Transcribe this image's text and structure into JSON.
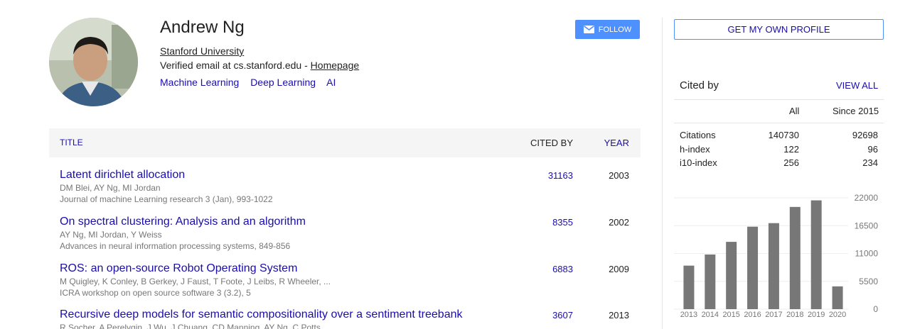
{
  "profile": {
    "name": "Andrew Ng",
    "affiliation": "Stanford University",
    "email_text": "Verified email at cs.stanford.edu - ",
    "homepage": "Homepage",
    "interests": [
      "Machine Learning",
      "Deep Learning",
      "AI"
    ],
    "follow_label": "FOLLOW",
    "own_profile_label": "GET MY OWN PROFILE"
  },
  "table": {
    "title_header": "TITLE",
    "cited_header": "CITED BY",
    "year_header": "YEAR",
    "articles": [
      {
        "title": "Latent dirichlet allocation",
        "authors": "DM Blei, AY Ng, MI Jordan",
        "venue": "Journal of machine Learning research 3 (Jan), 993-1022",
        "cited": "31163",
        "year": "2003"
      },
      {
        "title": "On spectral clustering: Analysis and an algorithm",
        "authors": "AY Ng, MI Jordan, Y Weiss",
        "venue": "Advances in neural information processing systems, 849-856",
        "cited": "8355",
        "year": "2002"
      },
      {
        "title": "ROS: an open-source Robot Operating System",
        "authors": "M Quigley, K Conley, B Gerkey, J Faust, T Foote, J Leibs, R Wheeler, ...",
        "venue": "ICRA workshop on open source software 3 (3.2), 5",
        "cited": "6883",
        "year": "2009"
      },
      {
        "title": "Recursive deep models for semantic compositionality over a sentiment treebank",
        "authors": "R Socher, A Perelygin, J Wu, J Chuang, CD Manning, AY Ng, C Potts",
        "venue": "",
        "cited": "3607",
        "year": "2013"
      }
    ]
  },
  "cited_by": {
    "title": "Cited by",
    "view_all": "VIEW ALL",
    "col_all": "All",
    "col_since": "Since 2015",
    "rows": [
      {
        "label": "Citations",
        "all": "140730",
        "since": "92698"
      },
      {
        "label": "h-index",
        "all": "122",
        "since": "96"
      },
      {
        "label": "i10-index",
        "all": "256",
        "since": "234"
      }
    ]
  },
  "chart_data": {
    "type": "bar",
    "categories": [
      "2013",
      "2014",
      "2015",
      "2016",
      "2017",
      "2018",
      "2019",
      "2020"
    ],
    "values": [
      8600,
      10800,
      13300,
      16300,
      17000,
      20200,
      21500,
      4500
    ],
    "yticks": [
      "22000",
      "16500",
      "11000",
      "5500",
      "0"
    ],
    "ylim": [
      0,
      22000
    ],
    "bar_color": "#777777"
  },
  "colors": {
    "link": "#1a0dab",
    "accent": "#4d90fe"
  }
}
